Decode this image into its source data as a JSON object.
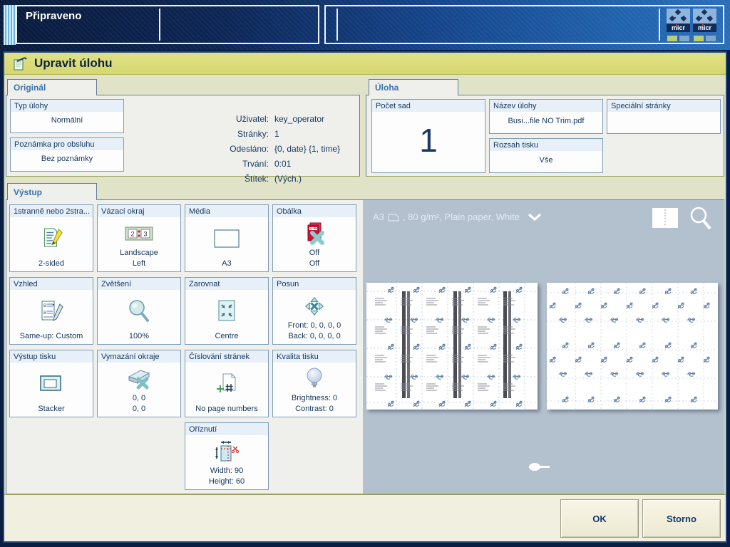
{
  "colors": {
    "title_bar": "#d9db79",
    "topbar_blue": "#1c59a4",
    "accent_blue": "#3c72ad",
    "preview_bg": "#b3c1cf",
    "status_green": "#b9cc7c",
    "status_light_blue": "#7fa6cc",
    "cover_red": "#d41038",
    "teal_accent": "#7ec0c6"
  },
  "top_bar": {
    "status": "Připraveno",
    "micr": {
      "label": "micr"
    }
  },
  "dialog": {
    "title": "Upravit úlohu"
  },
  "original": {
    "tab": "Originál",
    "tiles": [
      {
        "label": "Typ úlohy",
        "value": "Normální"
      },
      {
        "label": "Poznámka pro obsluhu",
        "value": "Bez poznámky"
      }
    ],
    "info": [
      {
        "label": "Uživatel:",
        "value": "key_operator"
      },
      {
        "label": "Stránky:",
        "value": "1"
      },
      {
        "label": "Odesláno:",
        "value": "{0, date} {1, time}"
      },
      {
        "label": "Trvání:",
        "value": "0:01"
      },
      {
        "label": "Štítek:",
        "value": "(Vých.)"
      }
    ]
  },
  "job": {
    "tab": "Úloha",
    "sets": {
      "label": "Počet sad",
      "value": "1"
    },
    "name": {
      "label": "Název úlohy",
      "value": "Busi...file NO Trim.pdf"
    },
    "range": {
      "label": "Rozsah tisku",
      "value": "Vše"
    },
    "special_pages": {
      "label": "Speciální stránky",
      "value": ""
    }
  },
  "output": {
    "tab": "Výstup",
    "tiles": [
      {
        "label": "1stranně nebo 2stra...",
        "value": "2-sided",
        "icon": "duplex-icon"
      },
      {
        "label": "Vázací okraj",
        "value": "Landscape\nLeft",
        "icon": "binding-edge-icon"
      },
      {
        "label": "Média",
        "value": "A3",
        "icon": "media-icon"
      },
      {
        "label": "Obálka",
        "value": "Off\nOff",
        "icon": "cover-off-icon"
      },
      {
        "label": "Vzhled",
        "value": "Same-up: Custom",
        "icon": "layout-icon"
      },
      {
        "label": "Zvětšení",
        "value": "100%",
        "icon": "magnifier-icon"
      },
      {
        "label": "Zarovnat",
        "value": "Centre",
        "icon": "align-centre-icon"
      },
      {
        "label": "Posun",
        "value": "Front: 0, 0, 0, 0\nBack: 0, 0, 0, 0",
        "icon": "image-shift-icon"
      },
      {
        "label": "Výstup tisku",
        "value": "Stacker",
        "icon": "stacker-icon"
      },
      {
        "label": "Vymazání okraje",
        "value": "0, 0\n0, 0",
        "icon": "edge-erase-icon"
      },
      {
        "label": "Číslování stránek",
        "value": "No page numbers",
        "icon": "page-numbers-icon"
      },
      {
        "label": "Kvalita tisku",
        "value": "Brightness: 0\nContrast: 0",
        "icon": "print-quality-icon"
      },
      {
        "label": "Oříznutí",
        "value": "Width: 90\nHeight: 60",
        "icon": "crop-icon"
      }
    ],
    "preview": {
      "media_size": "A3",
      "media_detail": ", 80 g/m², Plain paper, White"
    }
  },
  "footer": {
    "ok": "OK",
    "cancel": "Storno"
  }
}
